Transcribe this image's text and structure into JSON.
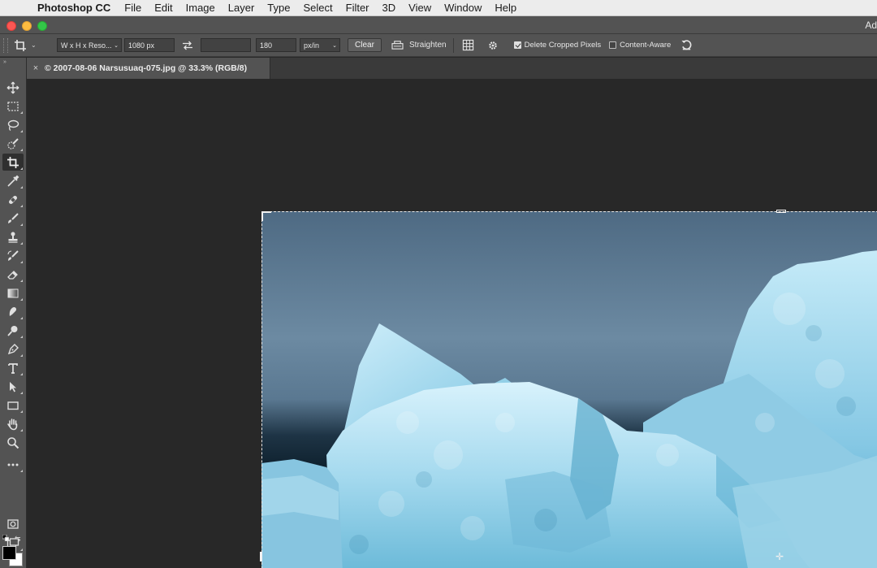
{
  "menubar": {
    "apple_glyph": "",
    "app_name": "Photoshop CC",
    "menus": [
      "File",
      "Edit",
      "Image",
      "Layer",
      "Type",
      "Select",
      "Filter",
      "3D",
      "View",
      "Window",
      "Help"
    ],
    "right_clip": "Ad"
  },
  "titlebar": {
    "title_clip": "Ad"
  },
  "options": {
    "preset_label": "W x H x Reso...",
    "width_value": "1080 px",
    "height_value": "",
    "resolution_value": "180",
    "resolution_unit": "px/in",
    "clear_label": "Clear",
    "straighten_label": "Straighten",
    "delete_cropped_label": "Delete Cropped Pixels",
    "delete_cropped_checked": true,
    "content_aware_label": "Content-Aware",
    "content_aware_checked": false
  },
  "document": {
    "tab_close": "×",
    "tab_title": "© 2007-08-06 Narsusuaq-075.jpg @ 33.3% (RGB/8)"
  },
  "toolbar": {
    "collapse_glyph": "»",
    "tools": [
      {
        "name": "move-tool",
        "icon": "move-icon",
        "active": false
      },
      {
        "name": "marquee-tool",
        "icon": "rect-marquee-icon",
        "active": false
      },
      {
        "name": "lasso-tool",
        "icon": "lasso-icon",
        "active": false
      },
      {
        "name": "quick-selection-tool",
        "icon": "quick-select-icon",
        "active": false
      },
      {
        "name": "crop-tool",
        "icon": "crop-icon",
        "active": true
      },
      {
        "name": "eyedropper-tool",
        "icon": "eyedropper-icon",
        "active": false
      },
      {
        "name": "healing-brush-tool",
        "icon": "bandage-icon",
        "active": false
      },
      {
        "name": "brush-tool",
        "icon": "brush-icon",
        "active": false
      },
      {
        "name": "clone-stamp-tool",
        "icon": "stamp-icon",
        "active": false
      },
      {
        "name": "history-brush-tool",
        "icon": "history-brush-icon",
        "active": false
      },
      {
        "name": "eraser-tool",
        "icon": "eraser-icon",
        "active": false
      },
      {
        "name": "gradient-tool",
        "icon": "gradient-icon",
        "active": false
      },
      {
        "name": "smudge-tool",
        "icon": "smudge-icon",
        "active": false
      },
      {
        "name": "dodge-tool",
        "icon": "dodge-icon",
        "active": false
      },
      {
        "name": "pen-tool",
        "icon": "pen-icon",
        "active": false
      },
      {
        "name": "type-tool",
        "icon": "type-icon",
        "active": false
      },
      {
        "name": "path-selection-tool",
        "icon": "arrow-icon",
        "active": false
      },
      {
        "name": "rectangle-tool",
        "icon": "rectangle-icon",
        "active": false
      },
      {
        "name": "hand-tool",
        "icon": "hand-icon",
        "active": false
      },
      {
        "name": "zoom-tool",
        "icon": "zoom-icon",
        "active": false
      },
      {
        "name": "more-tools",
        "icon": "ellipsis-icon",
        "active": false
      }
    ],
    "foreground_color": "#000000",
    "background_color": "#ffffff"
  },
  "colors": {
    "ui_panel": "#535353",
    "canvas_bg": "#282828",
    "accent_sky": "#5c7a93",
    "ice": "#a8d7ea"
  }
}
